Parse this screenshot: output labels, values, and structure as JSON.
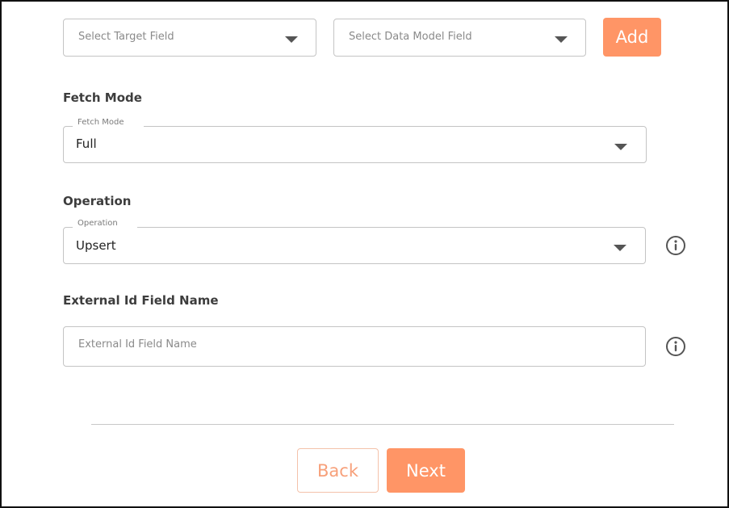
{
  "mapping": {
    "target_field": {
      "placeholder": "Select Target Field"
    },
    "data_model_field": {
      "placeholder": "Select Data Model Field"
    },
    "add_label": "Add"
  },
  "fetch_mode": {
    "heading": "Fetch Mode",
    "floating_label": "Fetch Mode",
    "value": "Full"
  },
  "operation": {
    "heading": "Operation",
    "floating_label": "Operation",
    "value": "Upsert"
  },
  "external_id": {
    "heading": "External Id Field Name",
    "placeholder": "External Id Field Name",
    "value": ""
  },
  "footer": {
    "back_label": "Back",
    "next_label": "Next"
  },
  "colors": {
    "accent": "#ff9566",
    "accent_border": "#f4c2aa",
    "text_heading": "#3d3d3d",
    "border": "#c4c4c4"
  }
}
